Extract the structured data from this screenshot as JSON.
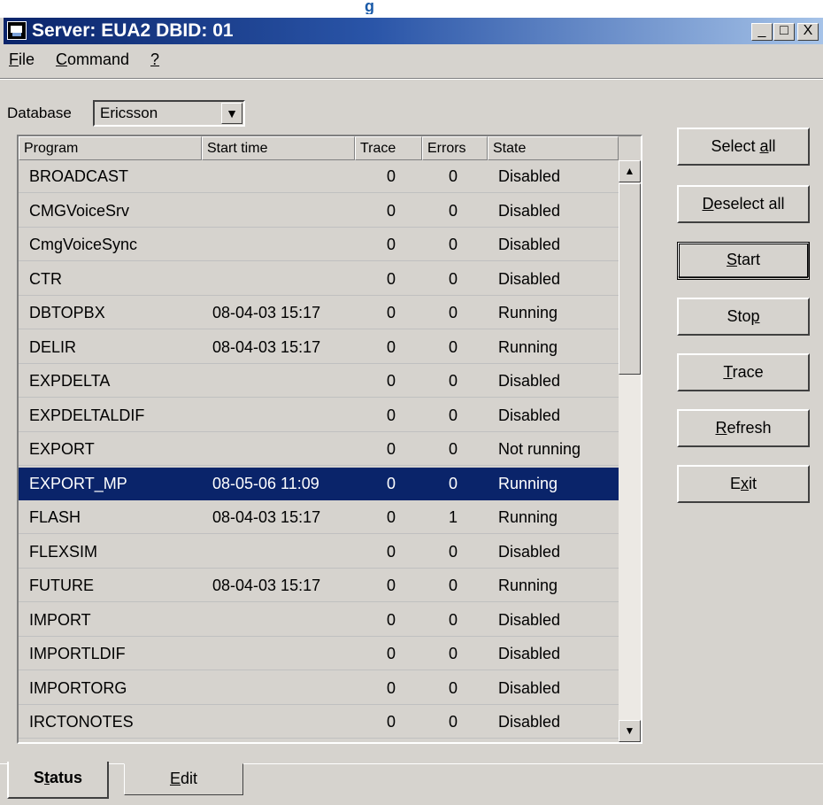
{
  "top_fragment": "g",
  "window": {
    "title": "Server: EUA2  DBID: 01",
    "minimize": "_",
    "maximize": "□",
    "close": "X"
  },
  "menu": [
    "File",
    "Command",
    "?"
  ],
  "database": {
    "label": "Database",
    "value": "Ericsson"
  },
  "table": {
    "columns": [
      "Program",
      "Start time",
      "Trace",
      "Errors",
      "State"
    ],
    "rows": [
      [
        "BROADCAST",
        "",
        "0",
        "0",
        "Disabled"
      ],
      [
        "CMGVoiceSrv",
        "",
        "0",
        "0",
        "Disabled"
      ],
      [
        "CmgVoiceSync",
        "",
        "0",
        "0",
        "Disabled"
      ],
      [
        "CTR",
        "",
        "0",
        "0",
        "Disabled"
      ],
      [
        "DBTOPBX",
        "08-04-03 15:17",
        "0",
        "0",
        "Running"
      ],
      [
        "DELIR",
        "08-04-03 15:17",
        "0",
        "0",
        "Running"
      ],
      [
        "EXPDELTA",
        "",
        "0",
        "0",
        "Disabled"
      ],
      [
        "EXPDELTALDIF",
        "",
        "0",
        "0",
        "Disabled"
      ],
      [
        "EXPORT",
        "",
        "0",
        "0",
        "Not running"
      ],
      [
        "EXPORT_MP",
        "08-05-06 11:09",
        "0",
        "0",
        "Running"
      ],
      [
        "FLASH",
        "08-04-03 15:17",
        "0",
        "1",
        "Running"
      ],
      [
        "FLEXSIM",
        "",
        "0",
        "0",
        "Disabled"
      ],
      [
        "FUTURE",
        "08-04-03 15:17",
        "0",
        "0",
        "Running"
      ],
      [
        "IMPORT",
        "",
        "0",
        "0",
        "Disabled"
      ],
      [
        "IMPORTLDIF",
        "",
        "0",
        "0",
        "Disabled"
      ],
      [
        "IMPORTORG",
        "",
        "0",
        "0",
        "Disabled"
      ],
      [
        "IRCTONOTES",
        "",
        "0",
        "0",
        "Disabled"
      ]
    ],
    "selected_index": 9
  },
  "buttons": [
    "Select all",
    "Deselect all",
    "Start",
    "Stop",
    "Trace",
    "Refresh",
    "Exit"
  ],
  "tabs": [
    "Status",
    "Edit"
  ]
}
